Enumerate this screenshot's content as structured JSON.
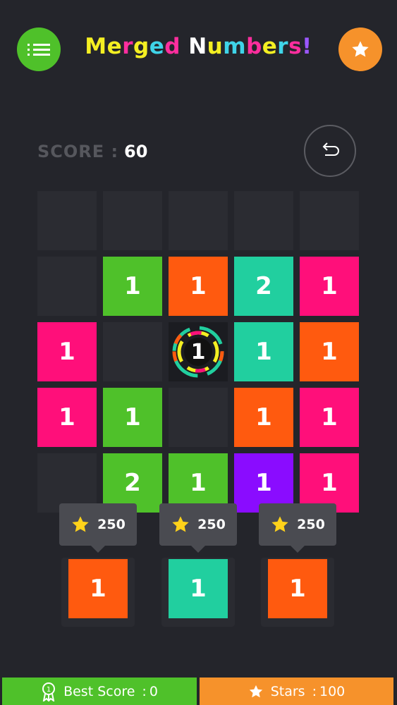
{
  "header": {
    "title_parts": [
      {
        "text": "Merged",
        "color": "#f4ef22"
      },
      {
        "text": " ",
        "color": "#ffffff"
      },
      {
        "text": "Numbers!",
        "color": "#3fd4e8"
      }
    ],
    "title_letter_colors": [
      "#f4ef22",
      "#f4ef22",
      "#ff2e9e",
      "#f4ef22",
      "#3fd4e8",
      "#ff2e9e",
      "#ffffff",
      "#f4ef22",
      "#3fd4e8",
      "#ff2e9e",
      "#f4ef22",
      "#3fd4e8",
      "#ff2e9e",
      "#9b57ff",
      "#9b57ff"
    ],
    "menu_icon": "list-icon",
    "star_icon": "star-icon"
  },
  "score": {
    "label": "SCORE :",
    "value": "60"
  },
  "undo_icon": "undo-icon",
  "colors": {
    "green": "#4fc12a",
    "orange": "#ff5a0f",
    "teal": "#21cf9f",
    "pink": "#ff0f7a",
    "purple": "#8a0cff",
    "empty": "#2b2c32"
  },
  "board": [
    [
      null,
      null,
      null,
      null,
      null
    ],
    [
      null,
      {
        "v": "1",
        "c": "green"
      },
      {
        "v": "1",
        "c": "orange"
      },
      {
        "v": "2",
        "c": "teal"
      },
      {
        "v": "1",
        "c": "pink"
      }
    ],
    [
      {
        "v": "1",
        "c": "pink"
      },
      null,
      {
        "v": "1",
        "c": "special"
      },
      {
        "v": "1",
        "c": "teal"
      },
      {
        "v": "1",
        "c": "orange"
      }
    ],
    [
      {
        "v": "1",
        "c": "pink"
      },
      {
        "v": "1",
        "c": "green"
      },
      null,
      {
        "v": "1",
        "c": "orange"
      },
      {
        "v": "1",
        "c": "pink"
      }
    ],
    [
      null,
      {
        "v": "2",
        "c": "green"
      },
      {
        "v": "1",
        "c": "green"
      },
      {
        "v": "1",
        "c": "purple"
      },
      {
        "v": "1",
        "c": "pink"
      }
    ]
  ],
  "tray": [
    {
      "value": "1",
      "color": "orange",
      "cost": "250"
    },
    {
      "value": "1",
      "color": "teal",
      "cost": "250"
    },
    {
      "value": "1",
      "color": "orange",
      "cost": "250"
    }
  ],
  "footer": {
    "best_score_label": "Best Score",
    "best_score_sep": ":",
    "best_score_value": "0",
    "best_icon": "ribbon-icon",
    "stars_label": "Stars",
    "stars_sep": ":",
    "stars_value": "100",
    "stars_icon": "star-icon"
  }
}
